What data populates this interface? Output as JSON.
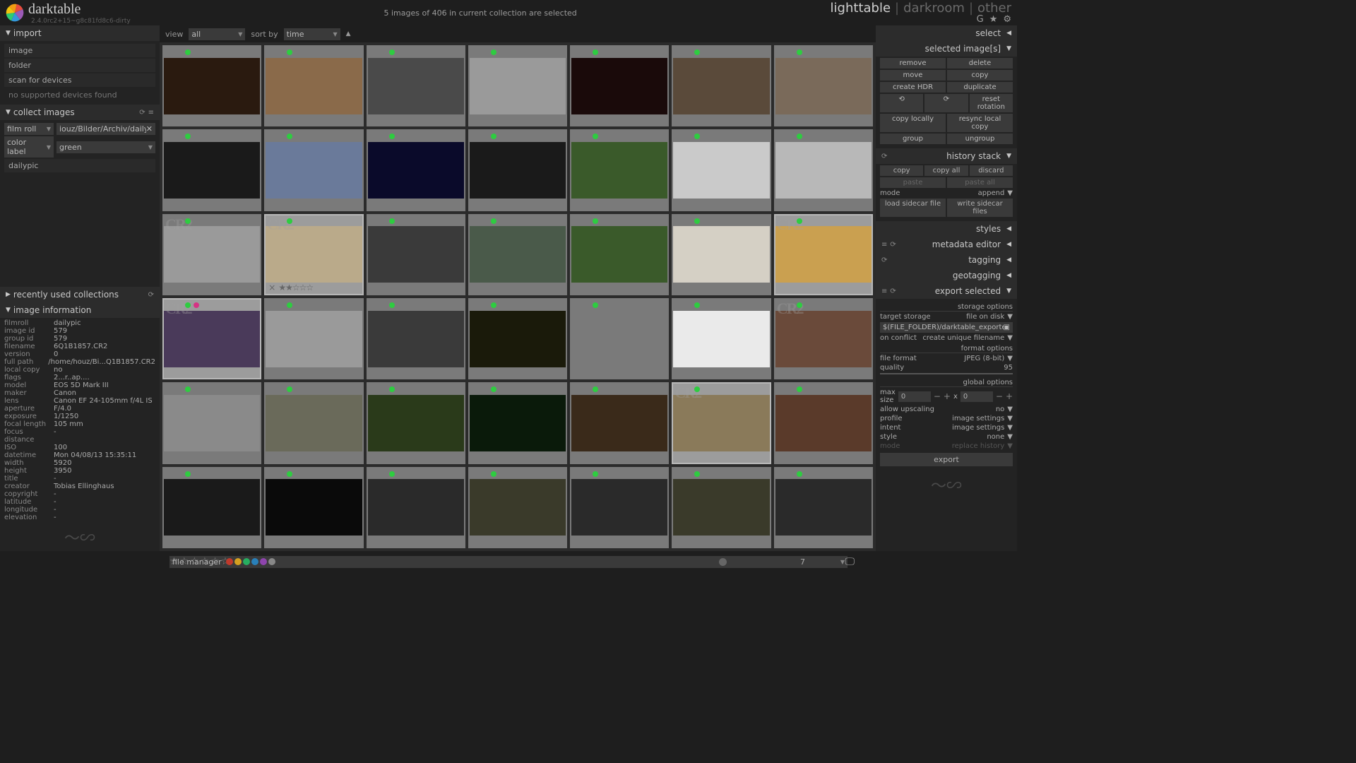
{
  "app_name": "darktable",
  "app_version": "2.4.0rc2+15~g8c81fd8c6-dirty",
  "status": "5 images of 406 in current collection are selected",
  "views": {
    "lighttable": "lighttable",
    "darkroom": "darkroom",
    "other": "other"
  },
  "toolbar": {
    "view_label": "view",
    "view_value": "all",
    "sort_label": "sort by",
    "sort_value": "time"
  },
  "import": {
    "title": "import",
    "items": [
      "image",
      "folder",
      "scan for devices"
    ],
    "status": "no supported devices found"
  },
  "collect": {
    "title": "collect images",
    "rule1_field": "film roll",
    "rule1_value": "iouz/Bilder/Archiv/dailypic",
    "rule2_field": "color label",
    "rule2_value": "green",
    "results": [
      "dailypic"
    ]
  },
  "recent": {
    "title": "recently used collections"
  },
  "image_info": {
    "title": "image information",
    "rows": [
      [
        "filmroll",
        "dailypic"
      ],
      [
        "image id",
        "579"
      ],
      [
        "group id",
        "579"
      ],
      [
        "filename",
        "6Q1B1857.CR2"
      ],
      [
        "version",
        "0"
      ],
      [
        "full path",
        "/home/houz/Bi...Q1B1857.CR2"
      ],
      [
        "local copy",
        "no"
      ],
      [
        "flags",
        "2...r..ap...."
      ],
      [
        "model",
        "EOS 5D Mark III"
      ],
      [
        "maker",
        "Canon"
      ],
      [
        "lens",
        "Canon EF 24-105mm f/4L IS"
      ],
      [
        "aperture",
        "F/4.0"
      ],
      [
        "exposure",
        "1/1250"
      ],
      [
        "focal length",
        "105 mm"
      ],
      [
        "focus distance",
        "-"
      ],
      [
        "ISO",
        "100"
      ],
      [
        "datetime",
        "Mon 04/08/13 15:35:11"
      ],
      [
        "width",
        "5920"
      ],
      [
        "height",
        "3950"
      ],
      [
        "title",
        "-"
      ],
      [
        "creator",
        "Tobias Ellinghaus"
      ],
      [
        "copyright",
        "-"
      ],
      [
        "latitude",
        "-"
      ],
      [
        "longitude",
        "-"
      ],
      [
        "elevation",
        "-"
      ]
    ]
  },
  "right": {
    "select_title": "select",
    "selected_images_title": "selected image[s]",
    "selected_buttons": [
      "remove",
      "delete",
      "move",
      "copy",
      "create HDR",
      "duplicate",
      "⟲",
      "⟳",
      "reset rotation",
      "copy locally",
      "resync local copy",
      "group",
      "ungroup"
    ],
    "history_title": "history stack",
    "history_buttons": [
      "copy",
      "copy all",
      "discard",
      "paste",
      "paste all"
    ],
    "history_mode_label": "mode",
    "history_mode_value": "append",
    "history_sidecar": [
      "load sidecar file",
      "write sidecar files"
    ],
    "styles_title": "styles",
    "metadata_title": "metadata editor",
    "tagging_title": "tagging",
    "geotag_title": "geotagging",
    "export_title": "export selected",
    "storage_options": "storage options",
    "target_storage_label": "target storage",
    "target_storage_value": "file on disk",
    "path_value": "$(FILE_FOLDER)/darktable_exported/img_",
    "conflict_label": "on conflict",
    "conflict_value": "create unique filename",
    "format_options": "format options",
    "file_format_label": "file format",
    "file_format_value": "JPEG (8-bit)",
    "quality_label": "quality",
    "quality_value": "95",
    "global_options": "global options",
    "max_size_label": "max size",
    "max_w": "0",
    "max_h": "0",
    "upscale_label": "allow upscaling",
    "upscale_value": "no",
    "profile_label": "profile",
    "profile_value": "image settings",
    "intent_label": "intent",
    "intent_value": "image settings",
    "style_label": "style",
    "style_value": "none",
    "mode_label": "mode",
    "mode_value": "replace history",
    "export_btn": "export"
  },
  "thumbs": [
    {
      "c": "#2a1a0f"
    },
    {
      "c": "#8a6a4a"
    },
    {
      "c": "#4a4a4a"
    },
    {
      "c": "#9a9a9a"
    },
    {
      "c": "#1a0a0a"
    },
    {
      "c": "#5a4a3a"
    },
    {
      "c": "#7a6a5a"
    },
    {
      "c": "#1a1a1a"
    },
    {
      "c": "#6a7a9a"
    },
    {
      "c": "#0a0a2a"
    },
    {
      "c": "#1a1a1a"
    },
    {
      "c": "#3a5a2a"
    },
    {
      "c": "#cacaca"
    },
    {
      "c": "#b8b8b8"
    },
    {
      "c": "#9a9a9a",
      "cr2": true
    },
    {
      "c": "#baaa8a",
      "cr2": true,
      "sel": true,
      "stars": true
    },
    {
      "c": "#3a3a3a"
    },
    {
      "c": "#4a5a4a"
    },
    {
      "c": "#3a5a2a"
    },
    {
      "c": "#d5d0c5"
    },
    {
      "c": "#caa050",
      "cr2": true,
      "sel": true
    },
    {
      "c": "#4a3a5a",
      "cr2": true,
      "sel": true,
      "extra": true
    },
    {
      "c": "#9a9a9a"
    },
    {
      "c": "#3a3a3a"
    },
    {
      "c": "#1a1a0a"
    },
    {
      "c": "#7a7a7a"
    },
    {
      "c": "#eaeaea"
    },
    {
      "c": "#6a4a3a",
      "cr2": true
    },
    {
      "c": "#8a8a8a"
    },
    {
      "c": "#6a6a5a"
    },
    {
      "c": "#2a3a1a"
    },
    {
      "c": "#0a1a0a"
    },
    {
      "c": "#3a2a1a"
    },
    {
      "c": "#8a7a5a",
      "cr2": true,
      "sel": true
    },
    {
      "c": "#5a3a2a"
    },
    {
      "c": "#1a1a1a"
    },
    {
      "c": "#0a0a0a"
    },
    {
      "c": "#2a2a2a"
    },
    {
      "c": "#3a3a2a"
    },
    {
      "c": "#2a2a2a"
    },
    {
      "c": "#3a3a2a"
    },
    {
      "c": "#2a2a2a"
    }
  ],
  "bottom": {
    "layout_value": "file manager",
    "zoom": "7"
  }
}
